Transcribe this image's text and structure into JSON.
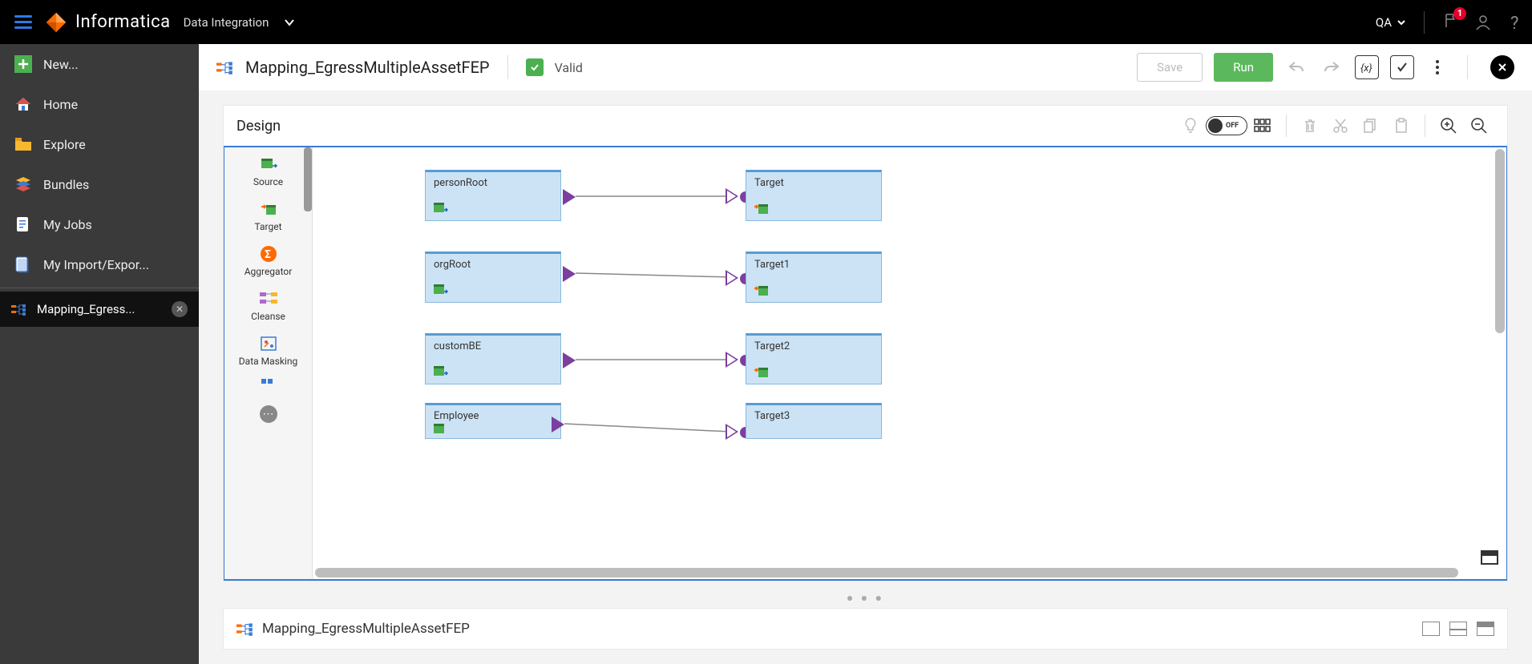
{
  "header": {
    "brand": "Informatica",
    "product": "Data Integration",
    "env": "QA",
    "notification_count": "1"
  },
  "sidebar": {
    "items": [
      {
        "label": "New..."
      },
      {
        "label": "Home"
      },
      {
        "label": "Explore"
      },
      {
        "label": "Bundles"
      },
      {
        "label": "My Jobs"
      },
      {
        "label": "My Import/Expor..."
      }
    ],
    "open_tab": "Mapping_Egress..."
  },
  "page": {
    "title": "Mapping_EgressMultipleAssetFEP",
    "valid_label": "Valid",
    "save_label": "Save",
    "run_label": "Run"
  },
  "canvas": {
    "title": "Design",
    "toggle_label": "OFF",
    "palette": [
      {
        "label": "Source"
      },
      {
        "label": "Target"
      },
      {
        "label": "Aggregator"
      },
      {
        "label": "Cleanse"
      },
      {
        "label": "Data Masking"
      }
    ],
    "nodes": {
      "personRoot": "personRoot",
      "orgRoot": "orgRoot",
      "customBE": "customBE",
      "employee": "Employee",
      "target": "Target",
      "target1": "Target1",
      "target2": "Target2",
      "target3": "Target3"
    }
  },
  "bottom": {
    "title": "Mapping_EgressMultipleAssetFEP"
  }
}
